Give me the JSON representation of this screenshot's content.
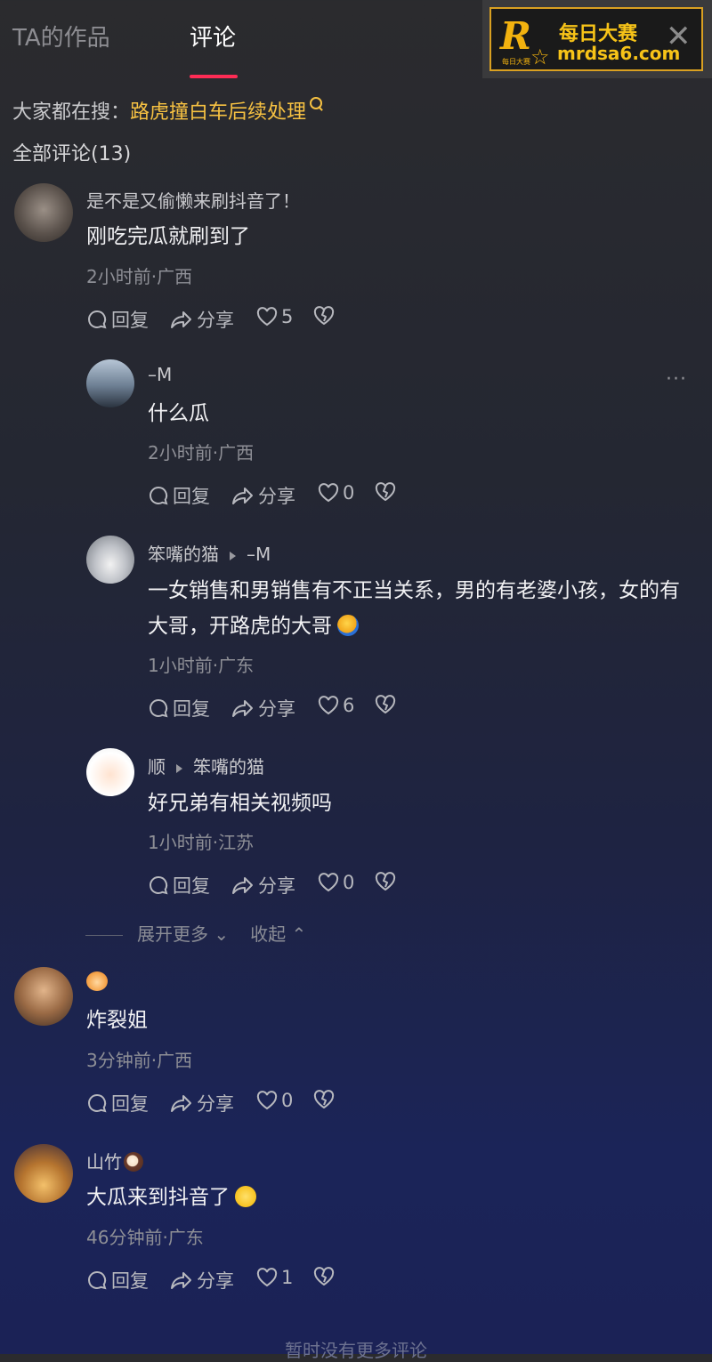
{
  "tabs": {
    "works": "TA的作品",
    "comments": "评论"
  },
  "ad": {
    "logo": "R",
    "sub": "每日大赛",
    "title": "每日大赛",
    "url": "mrdsa6.com",
    "close": "✕"
  },
  "search": {
    "prefix": "大家都在搜：",
    "term": "路虎撞白车后续处理"
  },
  "total": "全部评论(13)",
  "actions": {
    "reply": "回复",
    "share": "分享"
  },
  "comments": [
    {
      "name": "是不是又偷懒来刷抖音了！",
      "text": "刚吃完瓜就刷到了",
      "meta": "2小时前·广西",
      "likes": "5"
    },
    {
      "name": "–M",
      "text": "什么瓜",
      "meta": "2小时前·广西",
      "likes": "0",
      "more": "···"
    },
    {
      "name": "笨嘴的猫",
      "reply_to": "–M",
      "text": "一女销售和男销售有不正当关系，男的有老婆小孩，女的有大哥，开路虎的大哥",
      "meta": "1小时前·广东",
      "likes": "6"
    },
    {
      "name": "顺",
      "reply_to": "笨嘴的猫",
      "text": "好兄弟有相关视频吗",
      "meta": "1小时前·江苏",
      "likes": "0"
    },
    {
      "name": "",
      "text": "炸裂姐",
      "meta": "3分钟前·广西",
      "likes": "0"
    },
    {
      "name": "山竹",
      "text": "大瓜来到抖音了",
      "meta": "46分钟前·广东",
      "likes": "1"
    }
  ],
  "expand": {
    "more": "展开更多",
    "collapse": "收起"
  },
  "footer": "暂时没有更多评论"
}
